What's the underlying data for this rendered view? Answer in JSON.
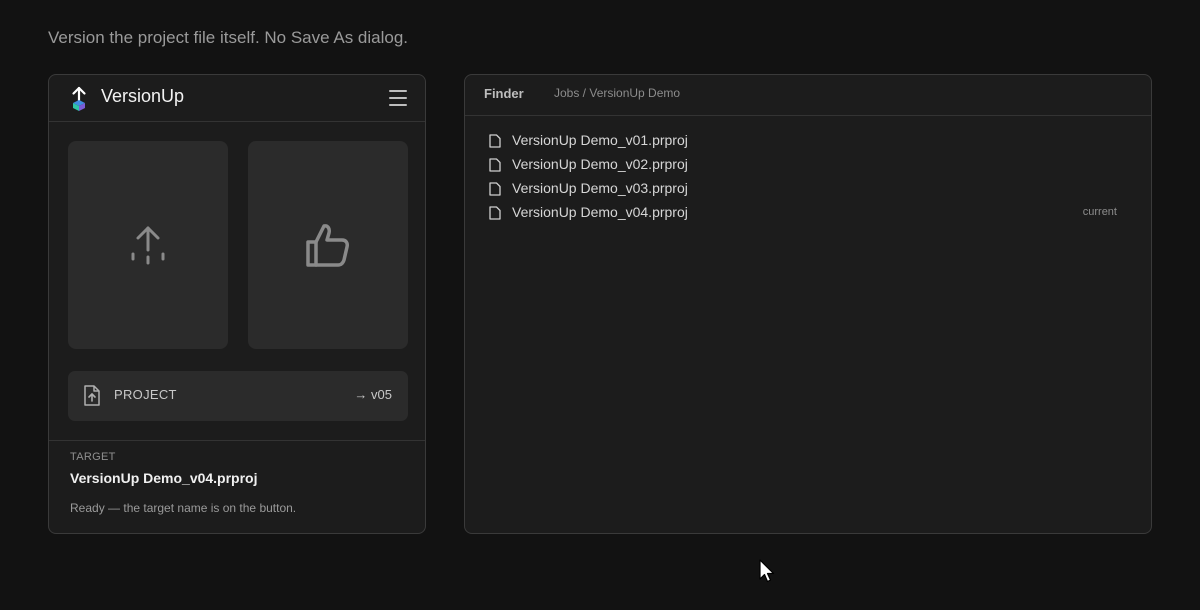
{
  "tagline": "Version the project file itself. No Save As dialog.",
  "app": {
    "title": "VersionUp",
    "logo_icon": "upload-arrow-icon",
    "menu_icon": "hamburger-menu-icon"
  },
  "tiles": [
    {
      "name": "version-up-tile",
      "icon": "upload-arrow-icon"
    },
    {
      "name": "approve-tile",
      "icon": "thumbs-up-icon"
    }
  ],
  "project_row": {
    "label": "PROJECT",
    "target": "→ v05",
    "icon": "file-upload-icon"
  },
  "target": {
    "label": "TARGET",
    "name": "VersionUp Demo_v04.prproj",
    "status": "Ready — the target name is on the button."
  },
  "finder": {
    "title": "Finder",
    "path": "Jobs / VersionUp Demo",
    "files": [
      {
        "name": "VersionUp Demo_v01.prproj",
        "badge": ""
      },
      {
        "name": "VersionUp Demo_v02.prproj",
        "badge": ""
      },
      {
        "name": "VersionUp Demo_v03.prproj",
        "badge": ""
      },
      {
        "name": "VersionUp Demo_v04.prproj",
        "badge": "current"
      }
    ]
  },
  "colors": {
    "background": "#121212",
    "panel": "#1c1c1c",
    "tile": "#2b2b2b",
    "border": "#3a3a3a",
    "logo_accent_blue": "#3f8de0",
    "logo_accent_teal": "#2fc4a6"
  }
}
